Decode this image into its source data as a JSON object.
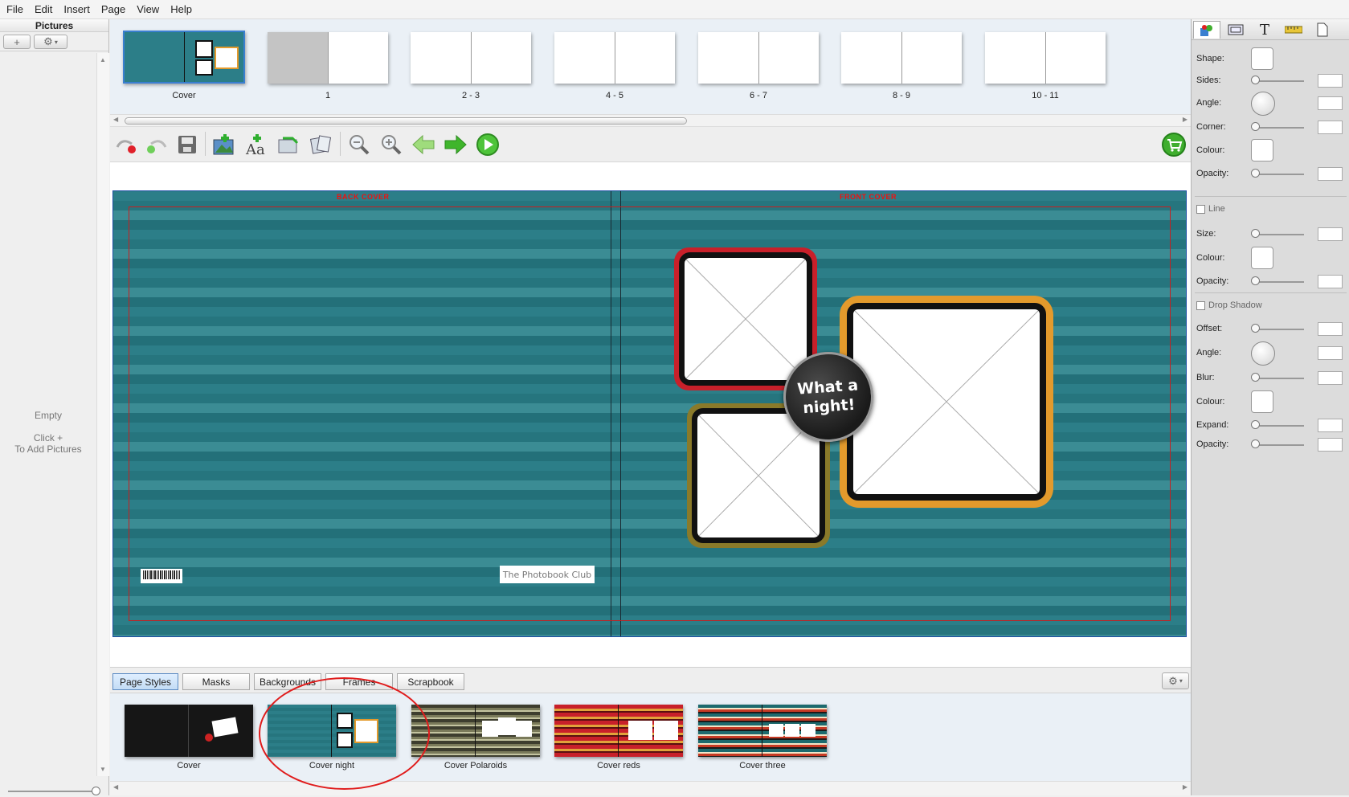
{
  "menu": [
    "File",
    "Edit",
    "Insert",
    "Page",
    "View",
    "Help"
  ],
  "left_panel": {
    "title": "Pictures",
    "add_button": "+",
    "empty_text": "Empty",
    "hint_line1": "Click +",
    "hint_line2": "To Add Pictures"
  },
  "page_strip": [
    {
      "label": "Cover"
    },
    {
      "label": "1"
    },
    {
      "label": "2 - 3"
    },
    {
      "label": "4 - 5"
    },
    {
      "label": "6 - 7"
    },
    {
      "label": "8 - 9"
    },
    {
      "label": "10 - 11"
    }
  ],
  "toolbar": {
    "icons": [
      "undo-icon",
      "redo-icon",
      "save-icon",
      "add-picture-icon",
      "add-text-icon",
      "import-icon",
      "layout-icon",
      "zoom-out-icon",
      "zoom-in-icon",
      "previous-page-icon",
      "next-page-icon",
      "play-icon",
      "cart-icon"
    ]
  },
  "canvas": {
    "back_cover_label": "BACK COVER",
    "front_cover_label": "FRONT COVER",
    "badge_line1": "What a",
    "badge_line2": "night!",
    "brand_logo": "The Photobook Club",
    "colors": {
      "background": "#2c7e88",
      "frame_red": "#c8202a",
      "frame_orange": "#e39a2c",
      "frame_olive": "#8a7a2a",
      "bleed_line": "#c62020"
    }
  },
  "bottom_tabs": [
    {
      "label": "Page Styles",
      "active": true
    },
    {
      "label": "Masks",
      "active": false
    },
    {
      "label": "Backgrounds",
      "active": false
    },
    {
      "label": "Frames",
      "active": false
    },
    {
      "label": "Scrapbook",
      "active": false
    }
  ],
  "styles": [
    {
      "label": "Cover",
      "colors": [
        "#111111",
        "#1b1b1b"
      ]
    },
    {
      "label": "Cover night",
      "colors": [
        "#2c7e88",
        "#26757e"
      ]
    },
    {
      "label": "Cover Polaroids",
      "colors": [
        "#3d3d2e",
        "#7a7a5a"
      ]
    },
    {
      "label": "Cover reds",
      "colors": [
        "#c8202a",
        "#e2a23a"
      ]
    },
    {
      "label": "Cover three",
      "colors": [
        "#1d6a6e",
        "#c63a24"
      ]
    }
  ],
  "properties": {
    "tabs": [
      "shape-icon",
      "box-icon",
      "text-icon",
      "ruler-icon",
      "page-icon"
    ],
    "shape_label": "Shape:",
    "sides_label": "Sides:",
    "angle_label": "Angle:",
    "corner_label": "Corner:",
    "colour_label": "Colour:",
    "opacity_label": "Opacity:",
    "line_section": "Line",
    "size_label": "Size:",
    "drop_shadow_section": "Drop Shadow",
    "offset_label": "Offset:",
    "blur_label": "Blur:",
    "expand_label": "Expand:"
  }
}
